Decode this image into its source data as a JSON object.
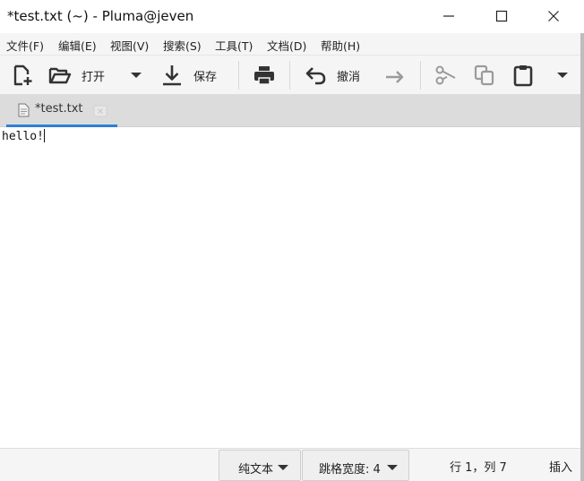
{
  "window": {
    "title": "*test.txt (~) - Pluma@jeven"
  },
  "menu": [
    "文件(F)",
    "编辑(E)",
    "视图(V)",
    "搜索(S)",
    "工具(T)",
    "文档(D)",
    "帮助(H)"
  ],
  "toolbar": {
    "open_label": "打开",
    "save_label": "保存",
    "undo_label": "撤消"
  },
  "tab": {
    "label": "*test.txt"
  },
  "editor": {
    "content": "hello!"
  },
  "status": {
    "syntax": "纯文本",
    "tab_width": "跳格宽度: 4",
    "position": "行 1，列 7",
    "mode": "插入"
  },
  "colors": {
    "accent": "#2f7ed8",
    "bar_background": "#f5f5f5",
    "tabbar_background": "#dcdcdc"
  }
}
